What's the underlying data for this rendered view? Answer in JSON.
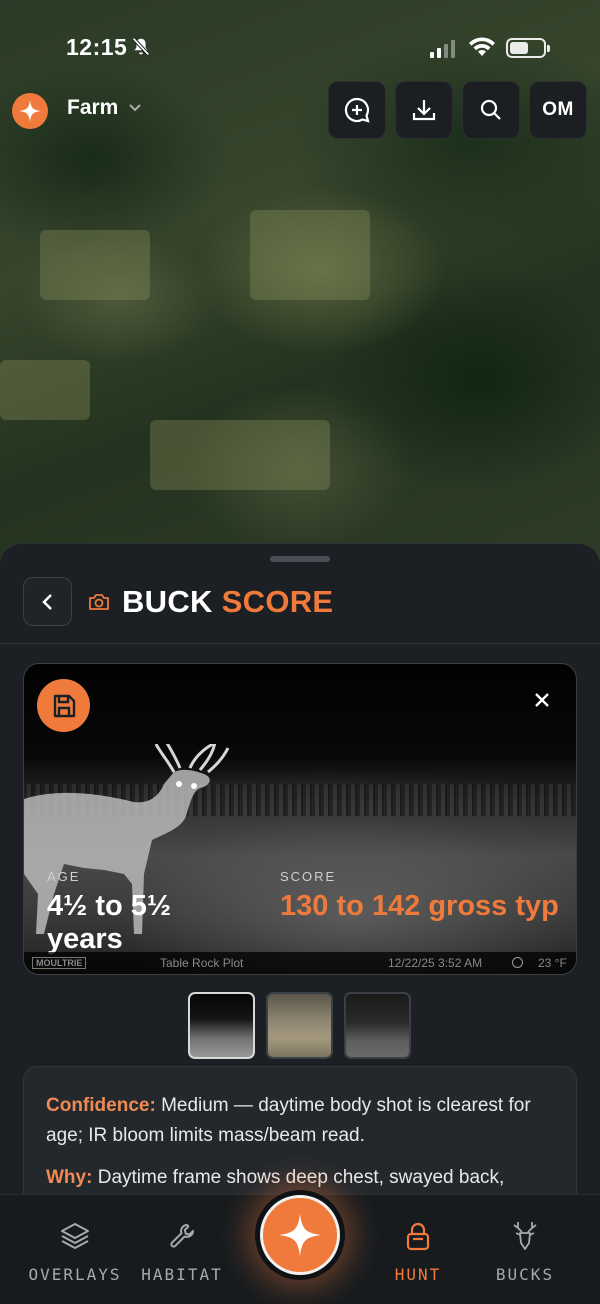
{
  "status_bar": {
    "time": "12:15",
    "battery_level": 0.55
  },
  "header": {
    "property_name": "Farm",
    "avatar_initials": "OM"
  },
  "sheet": {
    "title_part1": "BUCK",
    "title_part2": "SCORE",
    "age_label": "AGE",
    "age_value": "4½ to 5½ years",
    "score_label": "SCORE",
    "score_value": "130 to 142 gross typ",
    "camera_brand": "MOULTRIE",
    "camera_location": "Table Rock Plot",
    "camera_timestamp": "12/22/25 3:52 AM",
    "camera_temp": "23 °F",
    "confidence_label": "Confidence:",
    "confidence_text": "Medium — daytime body shot is clearest for age; IR bloom limits mass/beam read.",
    "why_label": "Why:",
    "why_text": "Daytime frame shows deep chest, swayed back,"
  },
  "nav": {
    "overlays": "OVERLAYS",
    "habitat": "HABITAT",
    "hunt": "HUNT",
    "bucks": "BUCKS"
  },
  "colors": {
    "accent": "#f07a3c",
    "sheet_bg": "#1c2024"
  }
}
